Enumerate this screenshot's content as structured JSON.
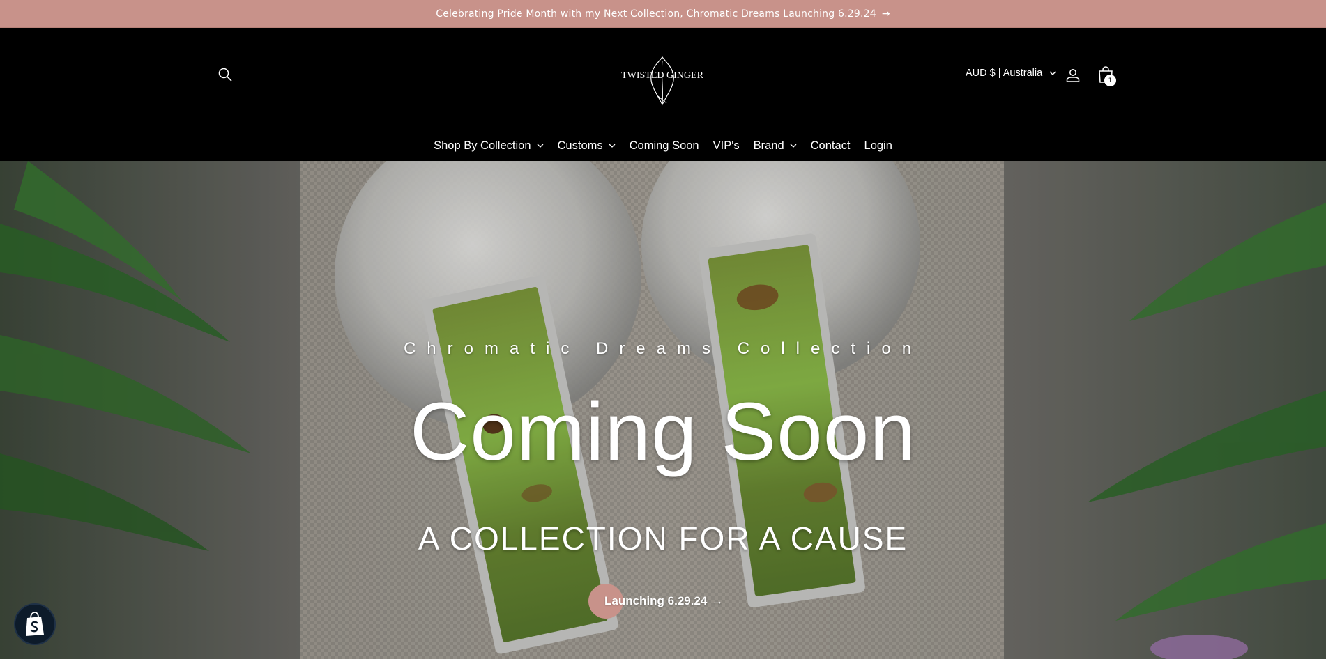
{
  "announcement": {
    "text": "Celebrating Pride Month with my Next Collection, Chromatic Dreams Launching 6.29.24",
    "arrow": "→"
  },
  "header": {
    "logo_text": "TWISTED GINGER",
    "currency": "AUD $ | Australia",
    "cart_count": "1",
    "icons": [
      "search-icon",
      "user-icon",
      "shopping-bag-icon",
      "chevron-down-icon"
    ]
  },
  "nav": {
    "items": [
      {
        "label": "Shop By Collection",
        "dropdown": true
      },
      {
        "label": "Customs",
        "dropdown": true
      },
      {
        "label": "Coming Soon",
        "dropdown": false
      },
      {
        "label": "VIP's",
        "dropdown": false
      },
      {
        "label": "Brand",
        "dropdown": true
      },
      {
        "label": "Contact",
        "dropdown": false
      },
      {
        "label": "Login",
        "dropdown": false
      }
    ]
  },
  "hero": {
    "eyebrow": "Chromatic Dreams Collection",
    "headline": "Coming Soon",
    "subheadline": "A COLLECTION FOR A CAUSE",
    "cta_label": "Launching 6.29.24",
    "cta_arrow": "→"
  },
  "colors": {
    "accent": "#c8928a",
    "header_bg": "#000000",
    "text": "#ffffff"
  }
}
